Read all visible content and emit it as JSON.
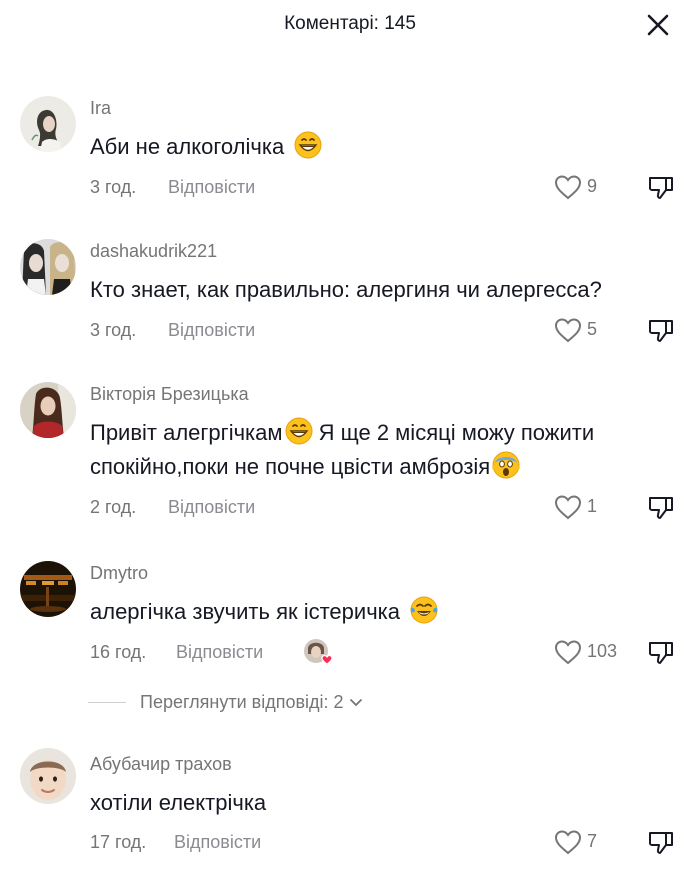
{
  "header": {
    "title": "Коментарі: 145",
    "close_icon": "close-icon"
  },
  "reply_label": "Відповісти",
  "comments": [
    {
      "username": "Ira",
      "text": "Аби не алкоголічка",
      "emojis": [
        "grinning-face-emoji"
      ],
      "time": "3 год.",
      "likes": "9",
      "avatar": "woman-profile-avatar"
    },
    {
      "username": "dashakudrik221",
      "text": "Кто знает, как правильно: алергиня чи алергесса?",
      "time": "3 год.",
      "likes": "5",
      "avatar": "two-girls-avatar"
    },
    {
      "username": "Вікторія Брезицька",
      "text_part1": "Привіт алегргічкам",
      "text_part2": " Я ще 2 місяці можу пожити спокійно,поки не почне цвісти амброзія",
      "emojis": [
        "grinning-face-emoji",
        "screaming-face-emoji"
      ],
      "time": "2 год.",
      "likes": "1",
      "avatar": "woman-brown-hair-avatar"
    },
    {
      "username": "Dmytro",
      "text": "алергічка звучить як істеричка",
      "emojis": [
        "tears-of-joy-emoji"
      ],
      "time": "16 год.",
      "likes": "103",
      "avatar": "dark-room-avatar",
      "liked_by_creator": true
    },
    {
      "username": "Абубачир трахов",
      "text": "хотіли електрічка",
      "time": "17 год.",
      "likes": "7",
      "avatar": "child-face-avatar"
    }
  ],
  "view_replies": {
    "label": "Переглянути відповіді: 2",
    "icon": "chevron-down-icon"
  },
  "colors": {
    "primary_text": "#161823",
    "secondary_text": "#757575",
    "divider": "#cfcfd3",
    "heart_badge": "#fe2c55"
  }
}
